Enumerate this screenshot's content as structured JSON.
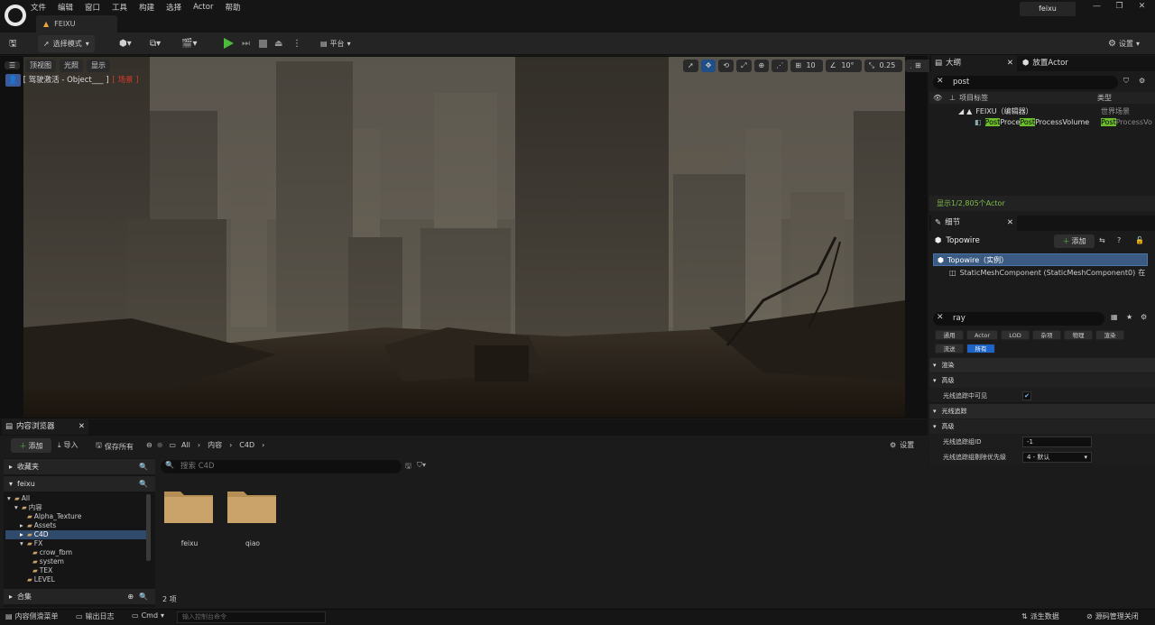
{
  "menu": [
    "文件",
    "编辑",
    "窗口",
    "工具",
    "构建",
    "选择",
    "Actor",
    "帮助"
  ],
  "doc_tab": "FEIXU",
  "user": "feixu",
  "window_controls": {
    "min": "—",
    "max": "❐",
    "close": "✕"
  },
  "toolbar": {
    "select_mode": "选择模式",
    "platform": "平台",
    "settings": "设置"
  },
  "viewport": {
    "view_top": "顶视图",
    "lit": "光照",
    "show": "显示",
    "grid": "10",
    "angle": "10°",
    "scale": "0.25",
    "speed": "6",
    "pilot_label": "[ 驾驶激活 - Object___ ]",
    "pilot_extra": "[ 场景 ]"
  },
  "outliner": {
    "tab": "大纲",
    "tab2": "放置Actor",
    "search": "post",
    "col_label": "项目标签",
    "col_type": "类型",
    "root": "FEIXU（编辑器）",
    "root_type": "世界场景",
    "row_hl1": "Post",
    "row_mid1": "Proce",
    "row_hl2": "Post",
    "row_rest": "ProcessVolume",
    "type_hl": "Post",
    "type_rest": "ProcessVo",
    "count": "显示1/2,805个Actor"
  },
  "details": {
    "tab": "细节",
    "actor": "Topowire",
    "add": "添加",
    "instance": "Topowire（实例）",
    "component": "StaticMeshComponent (StaticMeshComponent0)",
    "component_trail": "在",
    "search": "ray",
    "chips": [
      "通用",
      "Actor",
      "LOD",
      "杂项",
      "物理",
      "渲染",
      "流送",
      "所有"
    ],
    "sections": {
      "render": "渲染",
      "advanced": "高级",
      "raytracing": "光线追踪",
      "advanced2": "高级"
    },
    "props": {
      "visible_rt": "光线追踪中可见",
      "group_id_label": "光线追踪组ID",
      "group_id": "-1",
      "cull_label": "光线追踪组剔除优先级",
      "cull_value": "4 - 默认"
    }
  },
  "content": {
    "tab": "内容浏览器",
    "add": "添加",
    "import": "导入",
    "save_all": "保存所有",
    "path": [
      "All",
      "内容",
      "C4D"
    ],
    "settings": "设置",
    "favorites": "收藏夹",
    "project": "feixu",
    "search_placeholder": "搜索 C4D",
    "tree": [
      "All",
      "内容",
      "Alpha_Texture",
      "Assets",
      "C4D",
      "FX",
      "crow_fbm",
      "system",
      "TEX",
      "LEVEL"
    ],
    "collections": "合集",
    "folders": [
      "feixu",
      "qiao"
    ],
    "count": "2 项"
  },
  "status": {
    "drawer": "内容侧滑菜单",
    "log": "输出日志",
    "cmd": "Cmd",
    "console_placeholder": "输入控制台命令",
    "derived": "派生数据",
    "source": "源码管理关闭"
  }
}
